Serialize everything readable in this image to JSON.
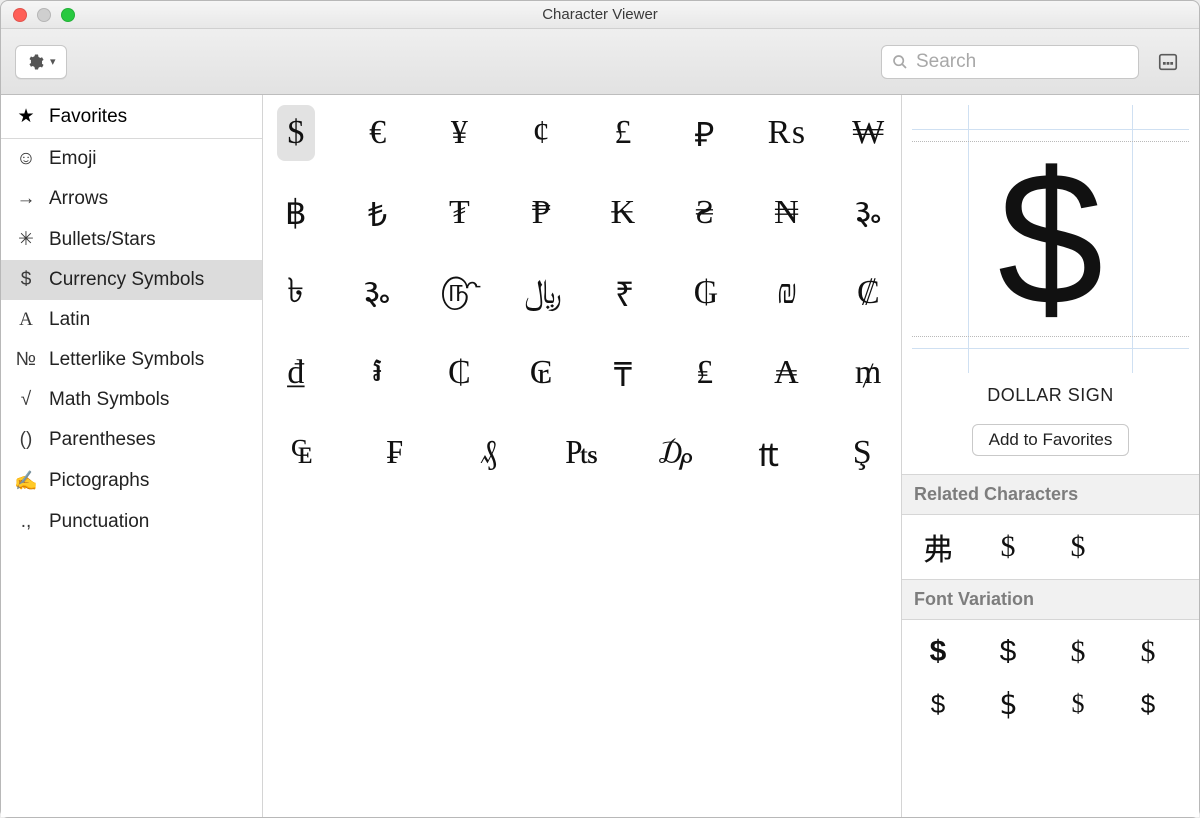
{
  "window": {
    "title": "Character Viewer"
  },
  "toolbar": {
    "search_placeholder": "Search"
  },
  "sidebar": {
    "favorites_label": "Favorites",
    "categories": [
      {
        "icon": "☺",
        "label": "Emoji"
      },
      {
        "icon": "→",
        "label": "Arrows"
      },
      {
        "icon": "✳",
        "label": "Bullets/Stars"
      },
      {
        "icon": "$",
        "label": "Currency Symbols",
        "selected": true
      },
      {
        "icon": "A",
        "label": "Latin"
      },
      {
        "icon": "№",
        "label": "Letterlike Symbols"
      },
      {
        "icon": "√",
        "label": "Math Symbols"
      },
      {
        "icon": "()",
        "label": "Parentheses"
      },
      {
        "icon": "✍",
        "label": "Pictographs"
      },
      {
        "icon": ".,",
        "label": "Punctuation"
      }
    ]
  },
  "grid": {
    "selected_index": 0,
    "chars": [
      "$",
      "€",
      "¥",
      "¢",
      "£",
      "₽",
      "₨",
      "₩",
      "฿",
      "₺",
      "₮",
      "₱",
      "₭",
      "₴",
      "₦",
      "૱",
      "৳",
      "૱",
      "௹",
      "﷼",
      "₹",
      "₲",
      "₪",
      "₡",
      "₫",
      "៛",
      "₵",
      "₢",
      "₸",
      "₤",
      "₳",
      "₥",
      "₠",
      "₣",
      "₰",
      "₧",
      "₯",
      "₶",
      "Ş",
      ""
    ]
  },
  "detail": {
    "big_char": "$",
    "name": "DOLLAR SIGN",
    "add_favorites_label": "Add to Favorites",
    "related_header": "Related Characters",
    "related": [
      "弗",
      "$",
      "$"
    ],
    "variation_header": "Font Variation",
    "variations_row1": [
      "$",
      "$",
      "$",
      "$"
    ],
    "variations_row2": [
      "$",
      "$",
      "$",
      "$"
    ]
  }
}
